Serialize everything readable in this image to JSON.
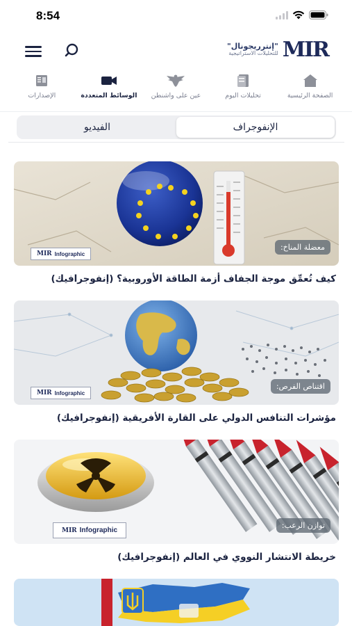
{
  "status_bar": {
    "time": "8:54"
  },
  "header": {
    "logo_mark": "MIR",
    "logo_line1": "\"إنترريجونال\"",
    "logo_line2": "للتحليلات الاستراتيجية"
  },
  "nav": {
    "items": [
      {
        "label": "الصفحة الرئيسية",
        "icon": "home-icon",
        "active": false
      },
      {
        "label": "تحليلات اليوم",
        "icon": "document-icon",
        "active": false
      },
      {
        "label": "عين على واشنطن",
        "icon": "eagle-icon",
        "active": false
      },
      {
        "label": "الوسائط المتعددة",
        "icon": "video-camera-icon",
        "active": true
      },
      {
        "label": "الإصدارات",
        "icon": "publications-icon",
        "active": false
      }
    ]
  },
  "tabs": {
    "infographic": "الإنفوجراف",
    "video": "الفيديو",
    "selected": "infographic"
  },
  "cards": [
    {
      "tag": "معضلة المناخ:",
      "badge": "Infographic",
      "title": "كيف تُعمِّق موجة الجفاف أزمة الطاقة الأوروبية؟ (إنفوجرافيك)"
    },
    {
      "tag": "اقتناص الفرص:",
      "badge": "Infographic",
      "title": "مؤشرات التنافس الدولي على القارة الأفريقية (إنفوجرافيك)"
    },
    {
      "tag": "توازن الرعب:",
      "badge": "Infographic",
      "title": "خريطة الانتشار النووي في العالم (إنفوجرافيك)"
    }
  ],
  "colors": {
    "primary": "#1b2340",
    "accent": "#c49a36",
    "muted": "#7c8091"
  }
}
